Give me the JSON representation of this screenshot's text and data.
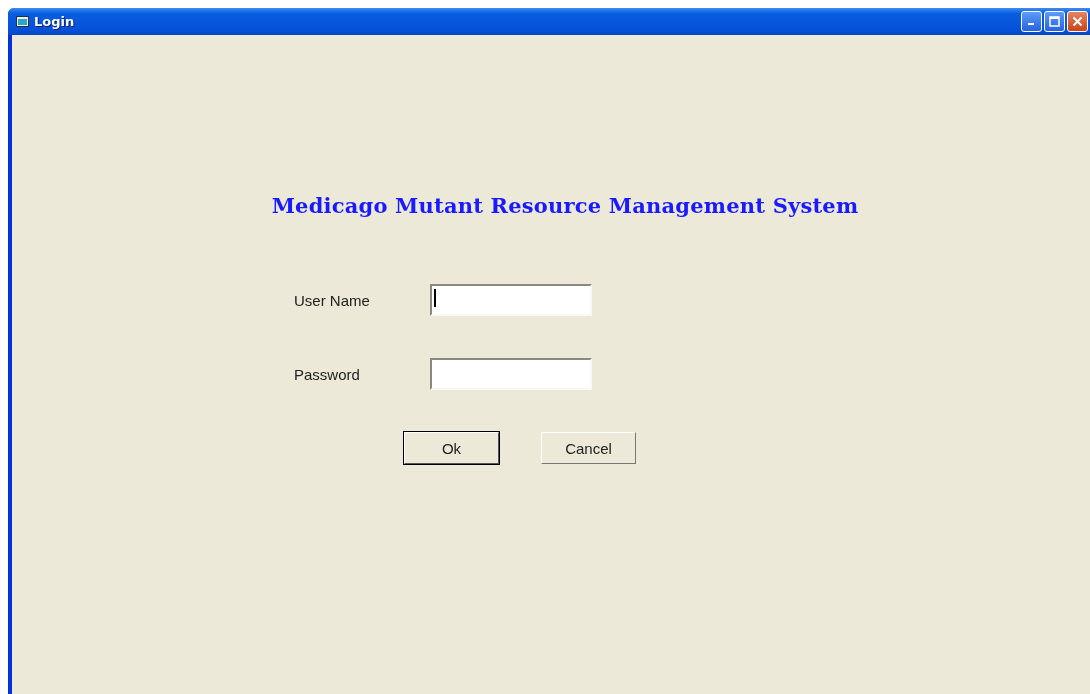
{
  "window": {
    "title": "Login"
  },
  "heading": "Medicago Mutant Resource Management System",
  "fields": [
    {
      "label": "User Name",
      "focused": true
    },
    {
      "label": "Password",
      "focused": false
    }
  ],
  "buttons": [
    {
      "label": "Ok",
      "default": true
    },
    {
      "label": "Cancel",
      "default": false
    }
  ]
}
